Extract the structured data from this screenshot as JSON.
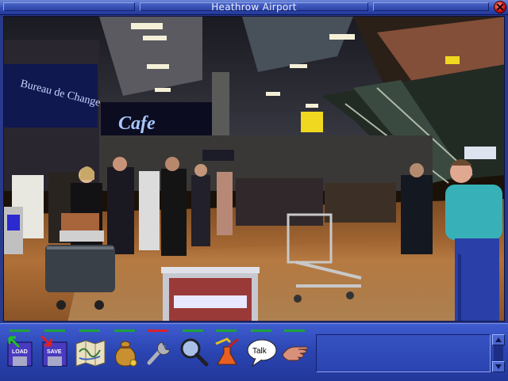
{
  "window": {
    "title": "Heathrow Airport"
  },
  "scene": {
    "cafe_sign": "Cafe",
    "bureau_sign": "Bureau de Change"
  },
  "toolbar": {
    "load_label": "LOAD",
    "save_label": "SAVE",
    "talk_label": "Talk",
    "active_tool": "wrench"
  }
}
